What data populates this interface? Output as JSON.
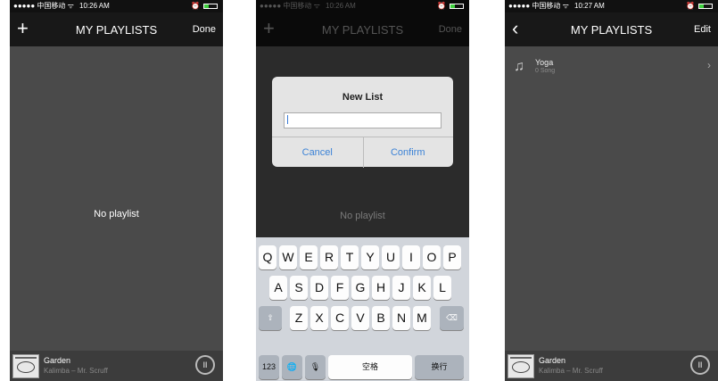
{
  "screens": [
    {
      "status": {
        "signal": "●●●●● 中国移动 ᯤ",
        "time": "10:26 AM",
        "alarm": "⏰"
      },
      "nav": {
        "left": "+",
        "title": "MY PLAYLISTS",
        "right": "Done"
      },
      "empty_text": "No playlist",
      "player": {
        "song": "Garden",
        "artist": "Kalimba – Mr. Scruff",
        "control": "II"
      }
    },
    {
      "status": {
        "signal": "●●●●● 中国移动 ᯤ",
        "time": "10:26 AM",
        "alarm": "⏰"
      },
      "nav": {
        "left": "+",
        "title": "MY PLAYLISTS",
        "right": "Done"
      },
      "empty_text": "No playlist",
      "dialog": {
        "title": "New List",
        "input_value": "",
        "cancel": "Cancel",
        "confirm": "Confirm"
      },
      "keyboard": {
        "row1": [
          "Q",
          "W",
          "E",
          "R",
          "T",
          "Y",
          "U",
          "I",
          "O",
          "P"
        ],
        "row2": [
          "A",
          "S",
          "D",
          "F",
          "G",
          "H",
          "J",
          "K",
          "L"
        ],
        "row3": [
          "Z",
          "X",
          "C",
          "V",
          "B",
          "N",
          "M"
        ],
        "shift": "⇧",
        "backspace": "⌫",
        "numbers": "123",
        "globe": "🌐",
        "mic": "🎙",
        "space": "空格",
        "return": "换行"
      }
    },
    {
      "status": {
        "signal": "●●●●● 中国移动 ᯤ",
        "time": "10:27 AM",
        "alarm": "⏰"
      },
      "nav": {
        "left": "‹",
        "title": "MY PLAYLISTS",
        "right": "Edit"
      },
      "playlists": [
        {
          "name": "Yoga",
          "count": "0 Song"
        }
      ],
      "player": {
        "song": "Garden",
        "artist": "Kalimba – Mr. Scruff",
        "control": "II"
      }
    }
  ]
}
